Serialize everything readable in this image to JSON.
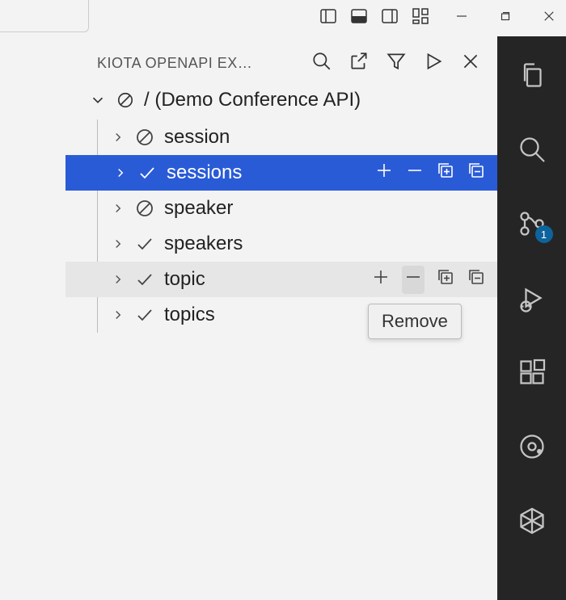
{
  "panel": {
    "title": "KIOTA OPENAPI EX…",
    "root_label": "/ (Demo Conference API)",
    "nodes": [
      {
        "label": "session",
        "state": "deny",
        "selected": false,
        "hover": false
      },
      {
        "label": "sessions",
        "state": "check",
        "selected": true,
        "hover": false
      },
      {
        "label": "speaker",
        "state": "deny",
        "selected": false,
        "hover": false
      },
      {
        "label": "speakers",
        "state": "check",
        "selected": false,
        "hover": false
      },
      {
        "label": "topic",
        "state": "check",
        "selected": false,
        "hover": true
      },
      {
        "label": "topics",
        "state": "check",
        "selected": false,
        "hover": false
      }
    ]
  },
  "tooltip": {
    "text": "Remove"
  },
  "activity": {
    "scm_badge": "1"
  }
}
